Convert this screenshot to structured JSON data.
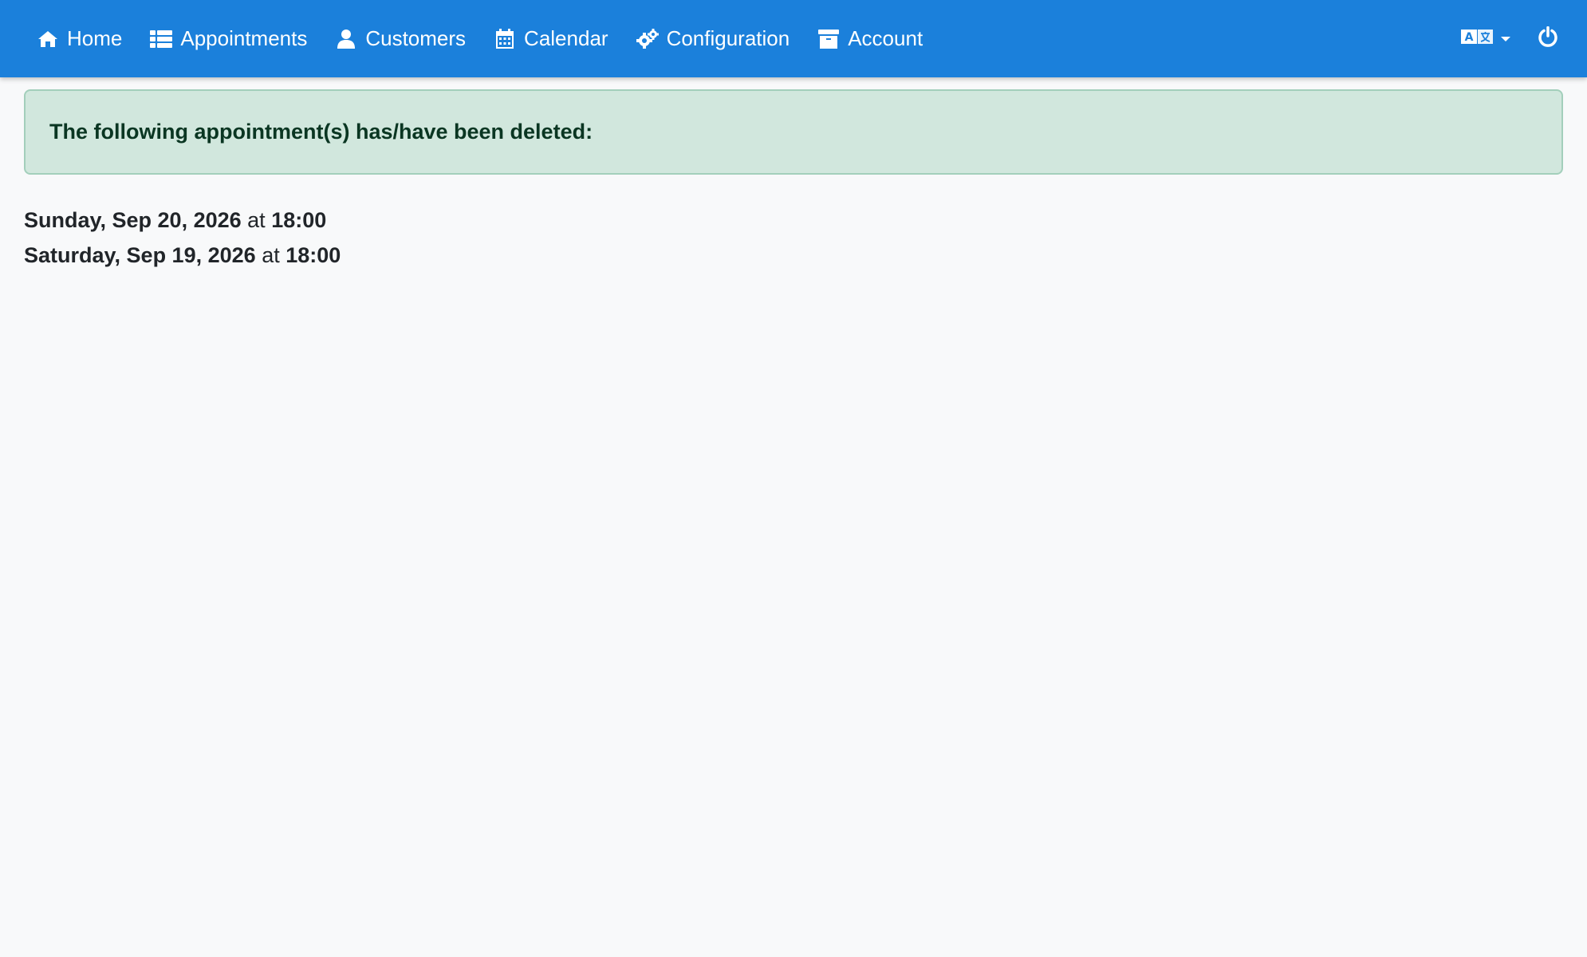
{
  "nav": {
    "items": [
      {
        "label": "Home",
        "icon": "home-icon"
      },
      {
        "label": "Appointments",
        "icon": "list-icon"
      },
      {
        "label": "Customers",
        "icon": "user-icon"
      },
      {
        "label": "Calendar",
        "icon": "calendar-icon"
      },
      {
        "label": "Configuration",
        "icon": "cogs-icon"
      },
      {
        "label": "Account",
        "icon": "archive-icon"
      }
    ],
    "right": {
      "language_icon": "language-icon",
      "logout_icon": "power-icon"
    }
  },
  "alert": {
    "text": "The following appointment(s) has/have been deleted:"
  },
  "deleted": [
    {
      "date": "Sunday, Sep 20, 2026",
      "connector": "at",
      "time": "18:00"
    },
    {
      "date": "Saturday, Sep 19, 2026",
      "connector": "at",
      "time": "18:00"
    }
  ],
  "colors": {
    "navbar": "#1b80db",
    "alert_bg": "#d1e7dd",
    "alert_text": "#0a3622",
    "page_bg": "#f8f9fa"
  }
}
